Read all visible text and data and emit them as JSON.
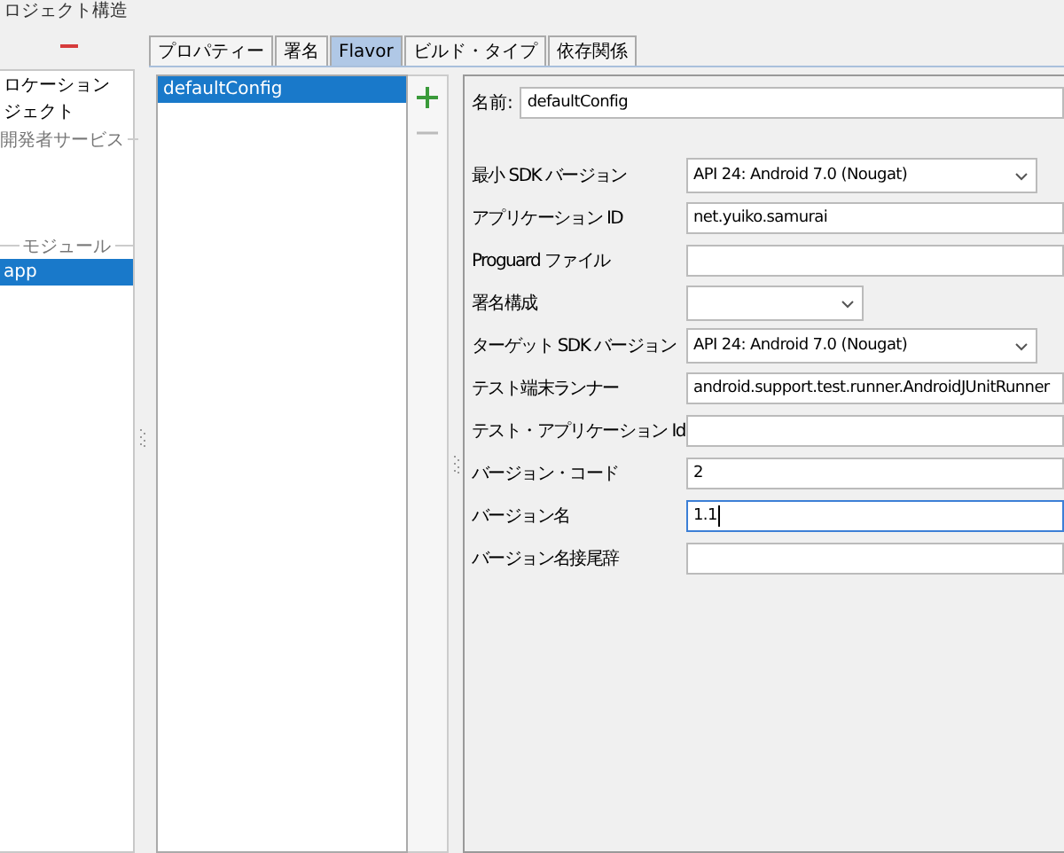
{
  "window": {
    "title": "ロジェクト構造"
  },
  "sidebar": {
    "items": [
      {
        "label": "ロケーション",
        "selected": false
      },
      {
        "label": "ジェクト",
        "selected": false
      }
    ],
    "services_header": "開発者サービス",
    "modules_header": "モジュール",
    "modules": [
      {
        "label": "app",
        "selected": true
      }
    ]
  },
  "tabs": [
    {
      "label": "プロパティー",
      "selected": false
    },
    {
      "label": "署名",
      "selected": false
    },
    {
      "label": "Flavor",
      "selected": true
    },
    {
      "label": "ビルド・タイプ",
      "selected": false
    },
    {
      "label": "依存関係",
      "selected": false
    }
  ],
  "flavors": {
    "items": [
      {
        "label": "defaultConfig",
        "selected": true
      }
    ],
    "add_button": {
      "disabled": false
    },
    "remove_button": {
      "disabled": true
    }
  },
  "form": {
    "name_label": "名前:",
    "name_value": "defaultConfig",
    "fields": [
      {
        "label": "最小 SDK バージョン",
        "kind": "dropdown",
        "value": "API 24: Android 7.0 (Nougat)",
        "focused": false
      },
      {
        "label": "アプリケーション ID",
        "kind": "text",
        "value": "net.yuiko.samurai",
        "focused": false
      },
      {
        "label": "Proguard ファイル",
        "kind": "text",
        "focused": false
      },
      {
        "label": "署名構成",
        "kind": "short_dropdown",
        "focused": false
      },
      {
        "label": "ターゲット SDK バージョン",
        "kind": "dropdown",
        "value": "API 24: Android 7.0 (Nougat)",
        "focused": false
      },
      {
        "label": "テスト端末ランナー",
        "kind": "text",
        "value": "android.support.test.runner.AndroidJUnitRunner",
        "focused": false
      },
      {
        "label": "テスト・アプリケーション Id",
        "kind": "text",
        "focused": false
      },
      {
        "label": "バージョン・コード",
        "kind": "text",
        "value": "2",
        "focused": false
      },
      {
        "label": "バージョン名",
        "kind": "text",
        "value": "1.1",
        "focused": true
      },
      {
        "label": "バージョン名接尾辞",
        "kind": "text",
        "focused": false
      }
    ]
  }
}
